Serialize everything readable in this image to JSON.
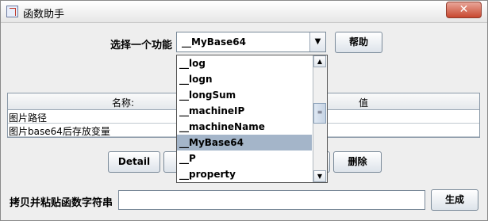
{
  "window": {
    "title": "函数助手",
    "close_glyph": "✕"
  },
  "function_select": {
    "label": "选择一个功能",
    "selected": "__MyBase64",
    "arrow_glyph": "▼"
  },
  "help_button": "帮助",
  "params_table": {
    "columns": [
      "名称:",
      "值"
    ],
    "rows": [
      {
        "name": "图片路径",
        "value": ""
      },
      {
        "name": "图片base64后存放变量",
        "value": ""
      }
    ]
  },
  "buttons": {
    "detail": "Detail",
    "delete": "删除"
  },
  "copy_paste": {
    "label": "拷贝并粘贴函数字符串",
    "value": "",
    "generate": "生成"
  },
  "dropdown": {
    "items": [
      "__log",
      "__logn",
      "__longSum",
      "__machineIP",
      "__machineName",
      "__MyBase64",
      "__P",
      "__property"
    ],
    "selected_index": 5,
    "up_glyph": "▲",
    "down_glyph": "▼",
    "thumb_glyph": "≡"
  }
}
